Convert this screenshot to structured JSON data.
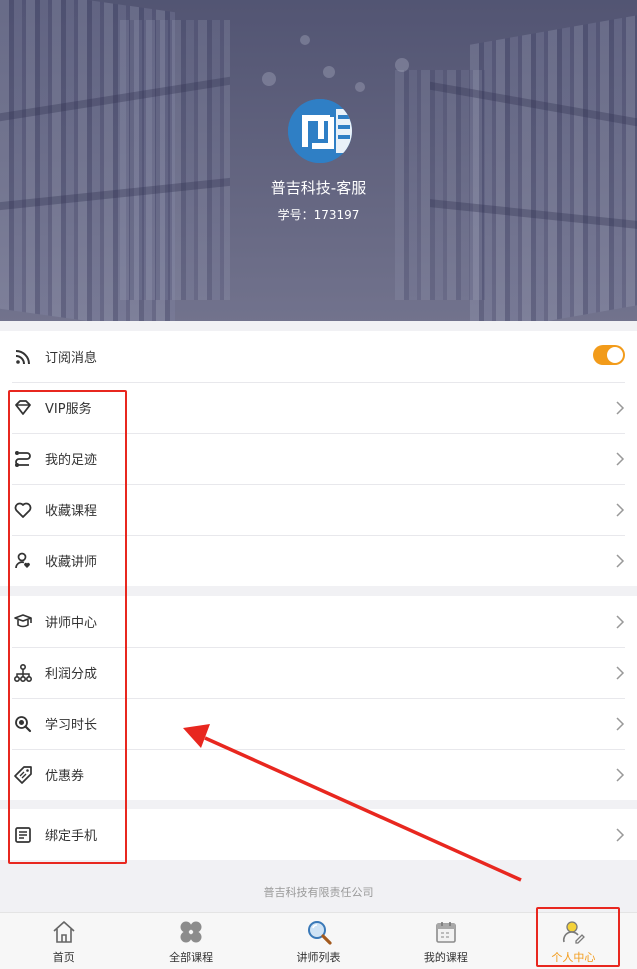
{
  "profile": {
    "name": "普吉科技-客服",
    "student_id": "学号：173197"
  },
  "menu_groups": [
    {
      "items": [
        {
          "label": "订阅消息",
          "icon": "rss-icon",
          "control": "toggle",
          "toggle_on": true
        },
        {
          "label": "VIP服务",
          "icon": "diamond-icon",
          "control": "chevron"
        },
        {
          "label": "我的足迹",
          "icon": "route-icon",
          "control": "chevron"
        },
        {
          "label": "收藏课程",
          "icon": "heart-icon",
          "control": "chevron"
        },
        {
          "label": "收藏讲师",
          "icon": "user-heart-icon",
          "control": "chevron"
        }
      ]
    },
    {
      "items": [
        {
          "label": "讲师中心",
          "icon": "graduation-cap-icon",
          "control": "chevron"
        },
        {
          "label": "利润分成",
          "icon": "network-icon",
          "control": "chevron"
        },
        {
          "label": "学习时长",
          "icon": "magnifier-icon",
          "control": "chevron"
        },
        {
          "label": "优惠券",
          "icon": "tag-icon",
          "control": "chevron"
        }
      ]
    },
    {
      "items": [
        {
          "label": "绑定手机",
          "icon": "contact-card-icon",
          "control": "chevron"
        }
      ]
    }
  ],
  "footer": {
    "company": "普吉科技有限责任公司"
  },
  "tabbar": [
    {
      "label": "首页",
      "icon": "home-icon",
      "active": false
    },
    {
      "label": "全部课程",
      "icon": "clover-icon",
      "active": false
    },
    {
      "label": "讲师列表",
      "icon": "search-icon",
      "active": false
    },
    {
      "label": "我的课程",
      "icon": "calendar-icon",
      "active": false
    },
    {
      "label": "个人中心",
      "icon": "user-icon",
      "active": true
    }
  ],
  "colors": {
    "accent": "#f29b1a",
    "annotation": "#e8271f",
    "avatar_bg": "#2f7fc5"
  }
}
